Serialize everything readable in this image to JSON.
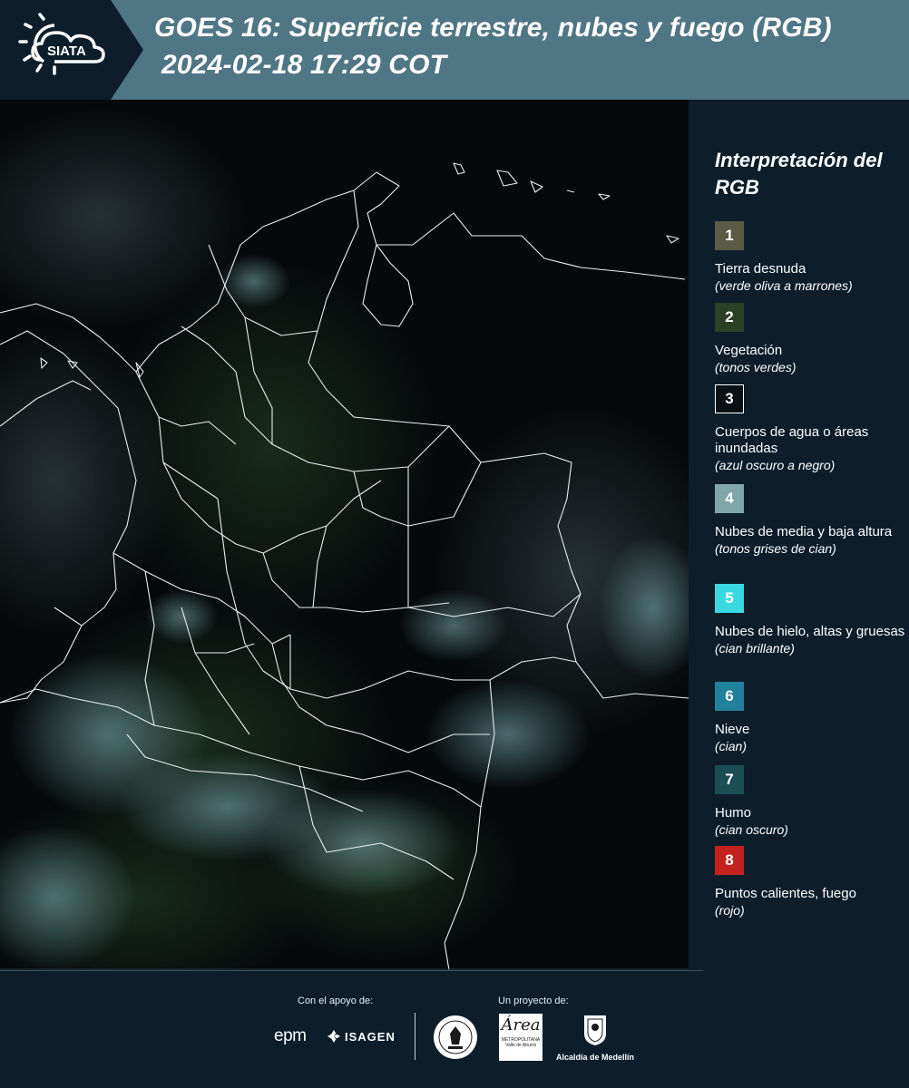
{
  "header": {
    "logo_text": "SIATA",
    "title_line1": "GOES 16: Superficie terrestre, nubes y fuego (RGB)",
    "title_line2": "2024-02-18 17:29 COT",
    "background_color": "#4f7685"
  },
  "legend": {
    "title": "Interpretación del RGB",
    "items": [
      {
        "number": "1",
        "label": "Tierra desnuda",
        "sub": "(verde oliva a marrones)",
        "color": "#5b5a44"
      },
      {
        "number": "2",
        "label": "Vegetación",
        "sub": "(tonos verdes)",
        "color": "#2c4025"
      },
      {
        "number": "3",
        "label": "Cuerpos de agua o áreas inundadas",
        "sub": "(azul oscuro a negro)",
        "color": "#0b1014"
      },
      {
        "number": "4",
        "label": "Nubes de media y baja altura",
        "sub": "(tonos grises de cian)",
        "color": "#7fa7a8"
      },
      {
        "number": "5",
        "label": "Nubes de hielo, altas y gruesas",
        "sub": "(cian brillante)",
        "color": "#3ad9e0"
      },
      {
        "number": "6",
        "label": "Nieve",
        "sub": "(cian)",
        "color": "#21819a"
      },
      {
        "number": "7",
        "label": "Humo",
        "sub": "(cian oscuro)",
        "color": "#1b4e53"
      },
      {
        "number": "8",
        "label": "Puntos calientes, fuego",
        "sub": "(rojo)",
        "color": "#c3221f"
      }
    ]
  },
  "footer": {
    "support_label": "Con el apoyo de:",
    "project_label": "Un proyecto de:",
    "sponsors": [
      "epm",
      "ISAGEN"
    ],
    "partners": [
      "Área Metropolitana Valle de Aburrá",
      "Alcaldía de Medellín"
    ],
    "area_logo_word": "Área",
    "area_logo_sub": "METROPOLITANA Valle de Aburrá"
  }
}
